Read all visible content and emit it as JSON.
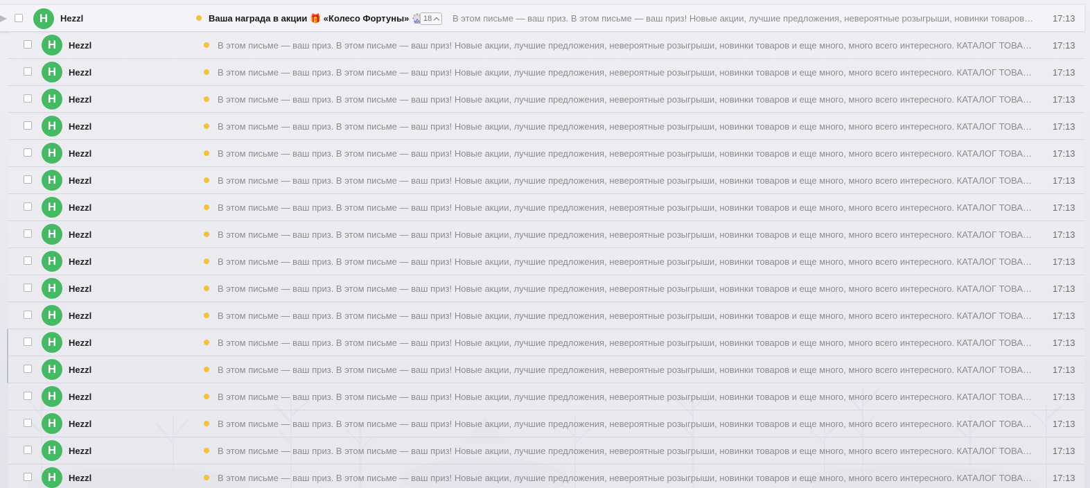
{
  "thread": {
    "sender": "Hezzl",
    "avatar_letter": "H",
    "subject": "Ваша награда в акции 🎁 «Колесо Фортуны» 🎡",
    "count": "18",
    "snippet": "В этом письме — ваш приз. В этом письме — ваш приз! Новые акции, лучшие предложения, невероятные розыгрыши, новинки товаров и еще много, много всего интересного. КАТАЛОГ ТОВАРОВ",
    "time": "17:13",
    "flag_icon": "thread-collapse-flag-icon",
    "count_icon": "chevron-up-icon"
  },
  "messages": [
    {
      "sender": "Hezzl",
      "avatar_letter": "H",
      "snippet": "В этом письме — ваш приз. В этом письме — ваш приз! Новые акции, лучшие предложения, невероятные розыгрыши, новинки товаров и еще много, много всего интересного. КАТАЛОГ ТОВАРОВ",
      "time": "17:13"
    },
    {
      "sender": "Hezzl",
      "avatar_letter": "H",
      "snippet": "В этом письме — ваш приз. В этом письме — ваш приз! Новые акции, лучшие предложения, невероятные розыгрыши, новинки товаров и еще много, много всего интересного. КАТАЛОГ ТОВАРОВ",
      "time": "17:13"
    },
    {
      "sender": "Hezzl",
      "avatar_letter": "H",
      "snippet": "В этом письме — ваш приз. В этом письме — ваш приз! Новые акции, лучшие предложения, невероятные розыгрыши, новинки товаров и еще много, много всего интересного. КАТАЛОГ ТОВАРОВ",
      "time": "17:13"
    },
    {
      "sender": "Hezzl",
      "avatar_letter": "H",
      "snippet": "В этом письме — ваш приз. В этом письме — ваш приз! Новые акции, лучшие предложения, невероятные розыгрыши, новинки товаров и еще много, много всего интересного. КАТАЛОГ ТОВАРОВ",
      "time": "17:13"
    },
    {
      "sender": "Hezzl",
      "avatar_letter": "H",
      "snippet": "В этом письме — ваш приз. В этом письме — ваш приз! Новые акции, лучшие предложения, невероятные розыгрыши, новинки товаров и еще много, много всего интересного. КАТАЛОГ ТОВАРОВ",
      "time": "17:13"
    },
    {
      "sender": "Hezzl",
      "avatar_letter": "H",
      "snippet": "В этом письме — ваш приз. В этом письме — ваш приз! Новые акции, лучшие предложения, невероятные розыгрыши, новинки товаров и еще много, много всего интересного. КАТАЛОГ ТОВАРОВ",
      "time": "17:13"
    },
    {
      "sender": "Hezzl",
      "avatar_letter": "H",
      "snippet": "В этом письме — ваш приз. В этом письме — ваш приз! Новые акции, лучшие предложения, невероятные розыгрыши, новинки товаров и еще много, много всего интересного. КАТАЛОГ ТОВАРОВ",
      "time": "17:13"
    },
    {
      "sender": "Hezzl",
      "avatar_letter": "H",
      "snippet": "В этом письме — ваш приз. В этом письме — ваш приз! Новые акции, лучшие предложения, невероятные розыгрыши, новинки товаров и еще много, много всего интересного. КАТАЛОГ ТОВАРОВ",
      "time": "17:13"
    },
    {
      "sender": "Hezzl",
      "avatar_letter": "H",
      "snippet": "В этом письме — ваш приз. В этом письме — ваш приз! Новые акции, лучшие предложения, невероятные розыгрыши, новинки товаров и еще много, много всего интересного. КАТАЛОГ ТОВАРОВ",
      "time": "17:13"
    },
    {
      "sender": "Hezzl",
      "avatar_letter": "H",
      "snippet": "В этом письме — ваш приз. В этом письме — ваш приз! Новые акции, лучшие предложения, невероятные розыгрыши, новинки товаров и еще много, много всего интересного. КАТАЛОГ ТОВАРОВ",
      "time": "17:13"
    },
    {
      "sender": "Hezzl",
      "avatar_letter": "H",
      "snippet": "В этом письме — ваш приз. В этом письме — ваш приз! Новые акции, лучшие предложения, невероятные розыгрыши, новинки товаров и еще много, много всего интересного. КАТАЛОГ ТОВАРОВ",
      "time": "17:13"
    },
    {
      "sender": "Hezzl",
      "avatar_letter": "H",
      "snippet": "В этом письме — ваш приз. В этом письме — ваш приз! Новые акции, лучшие предложения, невероятные розыгрыши, новинки товаров и еще много, много всего интересного. КАТАЛОГ ТОВАРОВ",
      "time": "17:13"
    },
    {
      "sender": "Hezzl",
      "avatar_letter": "H",
      "snippet": "В этом письме — ваш приз. В этом письме — ваш приз! Новые акции, лучшие предложения, невероятные розыгрыши, новинки товаров и еще много, много всего интересного. КАТАЛОГ ТОВАРОВ",
      "time": "17:13"
    },
    {
      "sender": "Hezzl",
      "avatar_letter": "H",
      "snippet": "В этом письме — ваш приз. В этом письме — ваш приз! Новые акции, лучшие предложения, невероятные розыгрыши, новинки товаров и еще много, много всего интересного. КАТАЛОГ ТОВАРОВ",
      "time": "17:13"
    },
    {
      "sender": "Hezzl",
      "avatar_letter": "H",
      "snippet": "В этом письме — ваш приз. В этом письме — ваш приз! Новые акции, лучшие предложения, невероятные розыгрыши, новинки товаров и еще много, много всего интересного. КАТАЛОГ ТОВАРОВ",
      "time": "17:13"
    },
    {
      "sender": "Hezzl",
      "avatar_letter": "H",
      "snippet": "В этом письме — ваш приз. В этом письме — ваш приз! Новые акции, лучшие предложения, невероятные розыгрыши, новинки товаров и еще много, много всего интересного. КАТАЛОГ ТОВАРОВ",
      "time": "17:13"
    },
    {
      "sender": "Hezzl",
      "avatar_letter": "H",
      "snippet": "В этом письме — ваш приз. В этом письме — ваш приз! Новые акции, лучшие предложения, невероятные розыгрыши, новинки товаров и еще много, много всего интересного. КАТАЛОГ ТОВАРОВ",
      "time": "17:13"
    }
  ],
  "colors": {
    "avatar_bg": "#45b963",
    "unread_dot": "#f6c03b",
    "snippet_text": "#8b8b90"
  }
}
